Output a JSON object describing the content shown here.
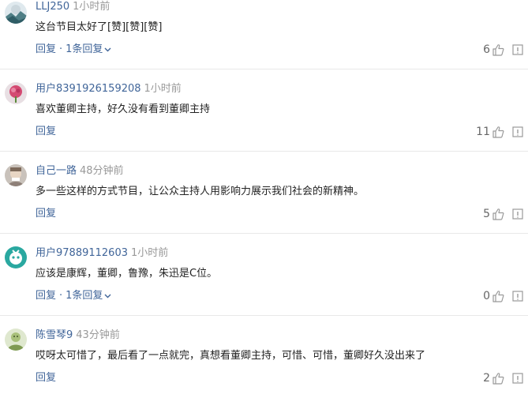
{
  "comments": [
    {
      "username": "LLJ250",
      "time": "1小时前",
      "text": "这台节目太好了[赞][赞][赞]",
      "reply_label": "回复",
      "more_replies_label": "1条回复",
      "likes": "6",
      "avatar_color": "#4f7f86"
    },
    {
      "username": "用户8391926159208",
      "time": "1小时前",
      "text": "喜欢董卿主持，好久没有看到董卿主持",
      "reply_label": "回复",
      "more_replies_label": "",
      "likes": "11",
      "avatar_color": "#d44a72"
    },
    {
      "username": "自己一路",
      "time": "48分钟前",
      "text": "多一些这样的方式节目，让公众主持人用影响力展示我们社会的新精神。",
      "reply_label": "回复",
      "more_replies_label": "",
      "likes": "5",
      "avatar_color": "#b0a295"
    },
    {
      "username": "用户97889112603",
      "time": "1小时前",
      "text": "应该是康辉，董卿，鲁豫，朱迅是C位。",
      "reply_label": "回复",
      "more_replies_label": "1条回复",
      "likes": "0",
      "avatar_color": "#2aa8a0"
    },
    {
      "username": "陈雪琴9",
      "time": "43分钟前",
      "text": "哎呀太可惜了，最后看了一点就完，真想看董卿主持，可惜、可惜，董卿好久没出来了",
      "reply_label": "回复",
      "more_replies_label": "",
      "likes": "2",
      "avatar_color": "#a8c07a"
    }
  ],
  "icons": {
    "like": "thumbs-up-icon",
    "report": "report-icon",
    "expand": "chevron-down-icon"
  }
}
